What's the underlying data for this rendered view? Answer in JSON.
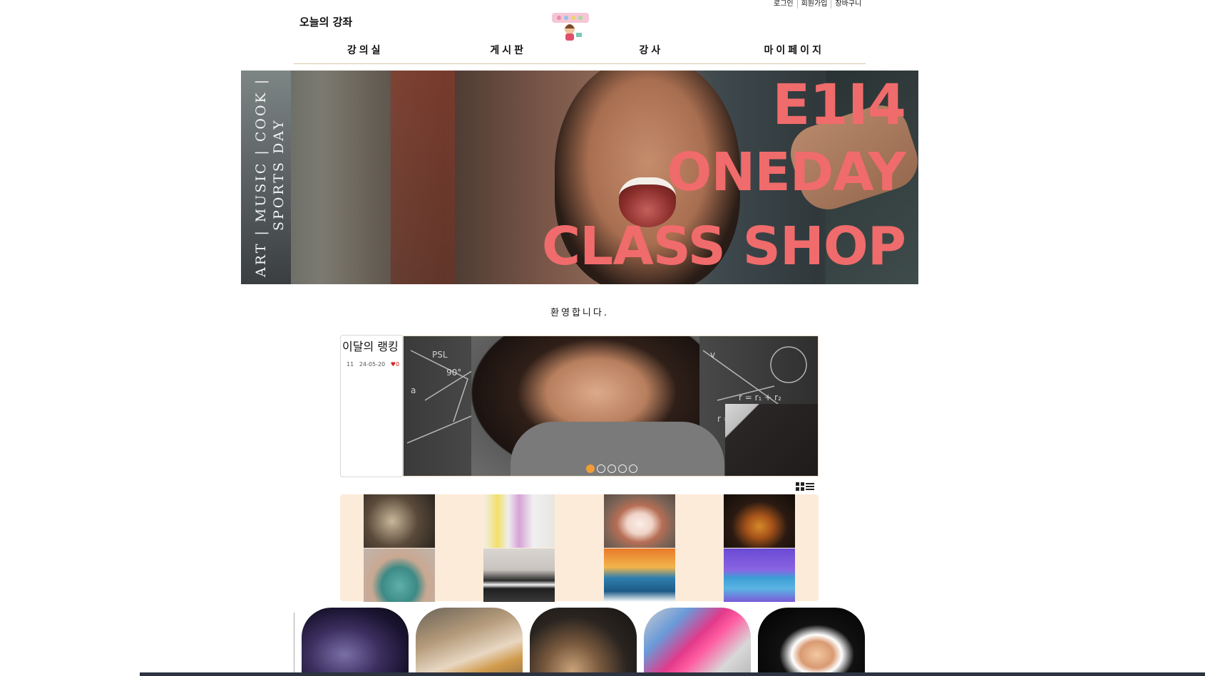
{
  "utility_links": [
    "로그인",
    "회원가입",
    "장바구니"
  ],
  "site_title": "오늘의 강좌",
  "nav": [
    "강의실",
    "게시판",
    "강사",
    "마이페이지"
  ],
  "hero": {
    "vertical_line1": "ART | MUSIC | COOK |",
    "vertical_line2": "SPORTS DAY",
    "title_line1": "E1I4",
    "title_line2": "ONEDAY",
    "title_line3": "CLASS SHOP",
    "title_color": "#f06b6b"
  },
  "welcome": "환영합니다.",
  "ranking": {
    "title": "이달의 랭킹",
    "item": {
      "id": "11",
      "date": "24-05-20",
      "likes": "0"
    }
  },
  "slider": {
    "dots": 5,
    "active_index": 0,
    "accent": "#f29c38"
  },
  "view_toggle": [
    "grid-view-icon",
    "list-view-icon"
  ],
  "grid": {
    "background": "#fdebd9",
    "thumbnails": [
      "craft-workshop",
      "colorful-drinks",
      "strawberry-cake",
      "electric-guitar",
      "knitting",
      "piano-lesson",
      "surfing",
      "table-tennis"
    ]
  },
  "cards": [
    "concert-singer",
    "sushi-making",
    "acoustic-guitar",
    "makeup-palette",
    "tennis-player"
  ]
}
